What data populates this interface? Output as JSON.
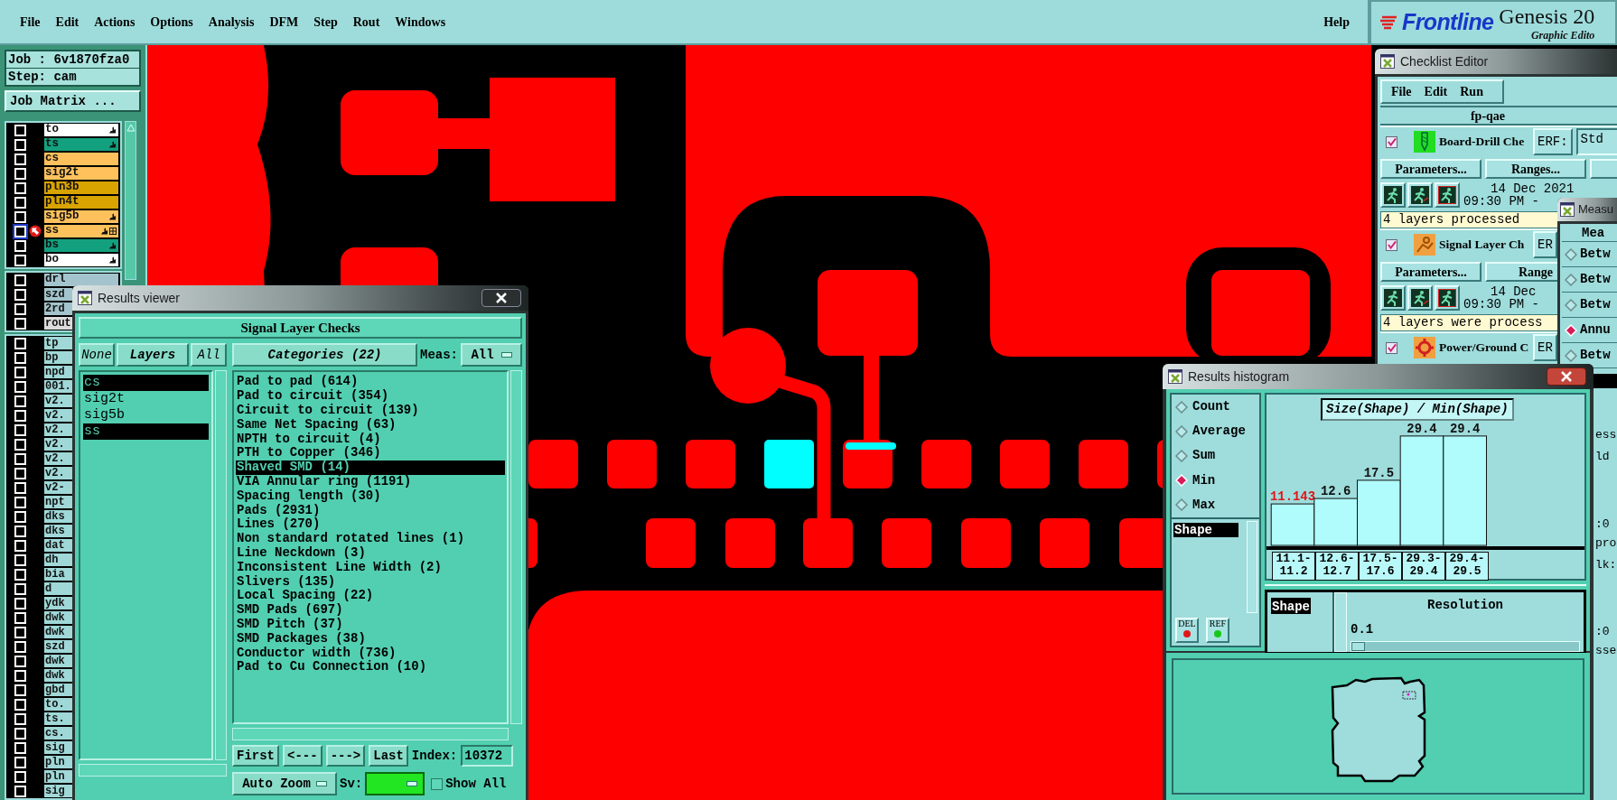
{
  "menu_bar": {
    "items": [
      "File",
      "Edit",
      "Actions",
      "Options",
      "Analysis",
      "DFM",
      "Step",
      "Rout",
      "Windows"
    ],
    "help": "Help"
  },
  "logo": {
    "brand": "Frontline",
    "product": "Genesis 20",
    "subtitle": "Graphic Edito"
  },
  "job_panel": {
    "job": "Job : 6v1870fza0",
    "step": "Step: cam",
    "matrix_button": "Job Matrix ...",
    "layer_groups": [
      {
        "layers": [
          {
            "name": "to",
            "color": "#ffffff",
            "checked": false,
            "hand": true,
            "work": false
          },
          {
            "name": "ts",
            "color": "#13a07e",
            "checked": false,
            "hand": true,
            "work": false
          },
          {
            "name": "cs",
            "color": "#ffc15c",
            "checked": false,
            "hand": false,
            "work": false
          },
          {
            "name": "sig2t",
            "color": "#ffc15c",
            "checked": false,
            "hand": false,
            "work": false
          },
          {
            "name": "pln3b",
            "color": "#d9a300",
            "checked": false,
            "hand": false,
            "work": false
          },
          {
            "name": "pln4t",
            "color": "#d9a300",
            "checked": false,
            "hand": false,
            "work": false
          },
          {
            "name": "sig5b",
            "color": "#ffc15c",
            "checked": false,
            "hand": true,
            "work": false
          },
          {
            "name": "ss",
            "color": "#ffc15c",
            "checked": false,
            "hand": true,
            "work": true
          },
          {
            "name": "bs",
            "color": "#13a07e",
            "checked": false,
            "hand": true,
            "work": false
          },
          {
            "name": "bo",
            "color": "#ffffff",
            "checked": false,
            "hand": true,
            "work": false
          }
        ]
      },
      {
        "layers": [
          {
            "name": "drl",
            "color": "#a3c4cc",
            "checked": false,
            "work": false
          },
          {
            "name": "szd",
            "color": "#a3c4cc",
            "checked": false
          },
          {
            "name": "2rd",
            "color": "#a3c4cc",
            "checked": false
          },
          {
            "name": "rout",
            "color": "#dcdcdc",
            "checked": false
          }
        ]
      },
      {
        "layers": [
          {
            "name": "tp",
            "checked": false
          },
          {
            "name": "bp",
            "checked": false
          },
          {
            "name": "npd",
            "checked": false
          },
          {
            "name": "001.",
            "checked": false
          },
          {
            "name": "v2.",
            "checked": false
          },
          {
            "name": "v2.",
            "checked": false
          },
          {
            "name": "v2.",
            "checked": false
          },
          {
            "name": "v2.",
            "checked": false
          },
          {
            "name": "v2.",
            "checked": false
          },
          {
            "name": "v2.",
            "checked": false
          },
          {
            "name": "v2-",
            "checked": false
          },
          {
            "name": "npt",
            "checked": false
          },
          {
            "name": "dks",
            "checked": false
          },
          {
            "name": "dks",
            "checked": false
          },
          {
            "name": "dat",
            "checked": false
          },
          {
            "name": "dh",
            "checked": false
          },
          {
            "name": "bia",
            "checked": false
          },
          {
            "name": "d",
            "checked": false
          },
          {
            "name": "ydk",
            "checked": false
          },
          {
            "name": "dwk",
            "checked": false
          },
          {
            "name": "dwk",
            "checked": false
          },
          {
            "name": "szd",
            "checked": false
          },
          {
            "name": "dwk",
            "checked": false
          },
          {
            "name": "dwk",
            "checked": false
          },
          {
            "name": "gbd",
            "checked": false
          },
          {
            "name": "to.",
            "checked": false
          },
          {
            "name": "ts.",
            "checked": false
          },
          {
            "name": "cs.",
            "checked": false
          },
          {
            "name": "sig",
            "checked": false
          },
          {
            "name": "pln",
            "checked": false
          },
          {
            "name": "pln",
            "checked": false
          },
          {
            "name": "sig",
            "checked": false
          }
        ]
      }
    ]
  },
  "results_viewer": {
    "title": "Results viewer",
    "heading": "Signal Layer Checks",
    "layer_buttons": [
      "None",
      "Layers",
      "All"
    ],
    "layers": [
      {
        "name": "cs",
        "selected": true
      },
      {
        "name": "sig2t",
        "selected": false
      },
      {
        "name": "sig5b",
        "selected": false
      },
      {
        "name": "ss",
        "selected": true
      }
    ],
    "categories_button": "Categories (22)",
    "meas_label": "Meas:",
    "meas_value": "All",
    "categories": [
      {
        "label": "Pad to pad (614)",
        "selected": false
      },
      {
        "label": "Pad to circuit (354)",
        "selected": false
      },
      {
        "label": "Circuit to circuit (139)",
        "selected": false
      },
      {
        "label": "Same Net Spacing (63)",
        "selected": false
      },
      {
        "label": "NPTH to circuit (4)",
        "selected": false
      },
      {
        "label": "PTH to Copper (346)",
        "selected": false
      },
      {
        "label": "Shaved SMD (14)",
        "selected": true
      },
      {
        "label": "VIA Annular ring (1191)",
        "selected": false
      },
      {
        "label": "Spacing length (30)",
        "selected": false
      },
      {
        "label": "Pads (2931)",
        "selected": false
      },
      {
        "label": "Lines (270)",
        "selected": false
      },
      {
        "label": "Non standard rotated lines (1)",
        "selected": false
      },
      {
        "label": "Line Neckdown (3)",
        "selected": false
      },
      {
        "label": "Inconsistent Line Width (2)",
        "selected": false
      },
      {
        "label": "Slivers (135)",
        "selected": false
      },
      {
        "label": "Local Spacing (22)",
        "selected": false
      },
      {
        "label": "SMD Pads (697)",
        "selected": false
      },
      {
        "label": "SMD Pitch (37)",
        "selected": false
      },
      {
        "label": "SMD Packages (38)",
        "selected": false
      },
      {
        "label": "Conductor width (736)",
        "selected": false
      },
      {
        "label": "Pad to Cu Connection (10)",
        "selected": false
      }
    ],
    "nav_buttons": [
      "First",
      "<---",
      "--->",
      "Last"
    ],
    "index_label": "Index:",
    "index_value": "10372",
    "zoom_mode": "Auto Zoom",
    "sv_label": "Sv:",
    "show_all": {
      "label": "Show All",
      "checked": false
    }
  },
  "checklist_editor": {
    "title": "Checklist Editor",
    "menu": [
      "File",
      "Edit",
      "Run"
    ],
    "checklist_name": "fp-qae",
    "actions": [
      {
        "kind": "drill",
        "checked": true,
        "name": "Board-Drill Che",
        "erf_button": "ERF:",
        "erf_value": "Std",
        "buttons": [
          "Parameters...",
          "Ranges..."
        ],
        "date": "14 Dec 2021",
        "time": "09:30 PM -",
        "status": "4 layers processed"
      },
      {
        "kind": "signal",
        "checked": true,
        "name": "Signal Layer Ch",
        "erf_button": "ER",
        "buttons": [
          "Parameters...",
          "Range"
        ],
        "date": "14 Dec",
        "time": "09:30 PM -",
        "status": "4 layers were process"
      },
      {
        "kind": "power",
        "checked": true,
        "name": "Power/Ground C",
        "erf_button": "ER"
      }
    ],
    "edge_fragments": [
      "ess",
      "ld",
      ":0",
      "pro",
      "lk:",
      ":0",
      "sse"
    ]
  },
  "measure_window": {
    "title": "Measu",
    "header": "Mea",
    "options": [
      {
        "label": "Betw",
        "selected": false
      },
      {
        "label": "Betw",
        "selected": false
      },
      {
        "label": "Betw",
        "selected": false
      },
      {
        "label": "Annu",
        "selected": true
      },
      {
        "label": "Betw",
        "selected": false
      }
    ]
  },
  "histogram": {
    "title": "Results histogram",
    "modes": [
      {
        "label": "Count",
        "selected": false
      },
      {
        "label": "Average",
        "selected": false
      },
      {
        "label": "Sum",
        "selected": false
      },
      {
        "label": "Min",
        "selected": true
      },
      {
        "label": "Max",
        "selected": false
      }
    ],
    "fields": [
      {
        "label": "Shape",
        "selected": true
      }
    ],
    "del_button": "DEL",
    "ref_button": "REF",
    "chart_data": {
      "type": "bar",
      "title": "Size(Shape) / Min(Shape)",
      "categories": [
        "11.1-11.2",
        "12.6-12.7",
        "17.5-17.6",
        "29.3-29.4",
        "29.4-29.5"
      ],
      "values": [
        11.143,
        12.6,
        17.5,
        29.4,
        29.4
      ],
      "data_labels": true
    },
    "resolution_fields": [
      {
        "label": "Shape",
        "selected": true
      }
    ],
    "resolution_label": "Resolution",
    "resolution_value": "0.1",
    "resolution_slider": {
      "level": 0.06
    }
  }
}
